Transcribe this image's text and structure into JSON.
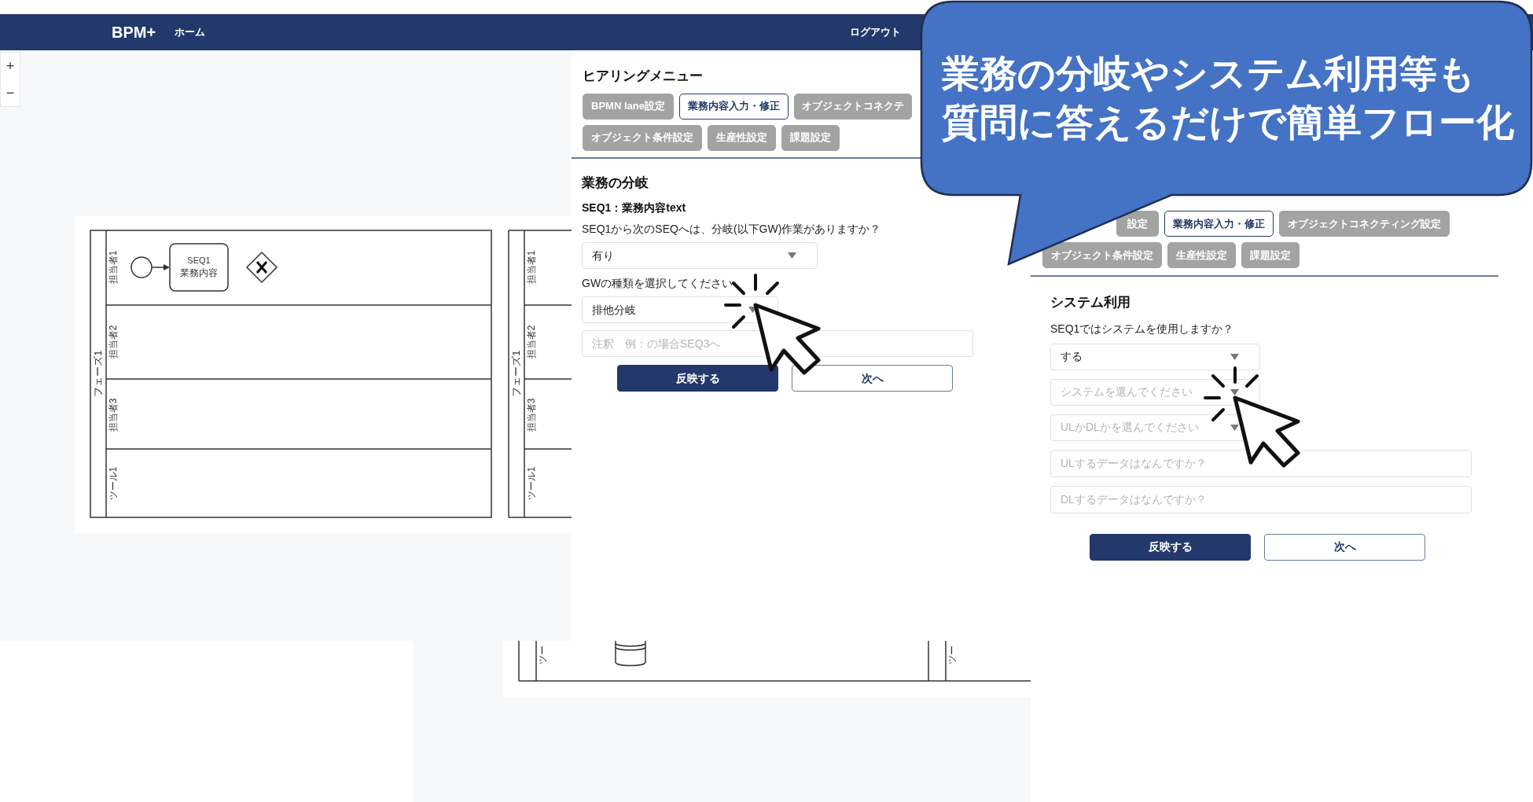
{
  "navbar": {
    "brand": "BPM+",
    "links": [
      "ホーム"
    ],
    "logout": "ログアウト"
  },
  "zoom_controls": [
    "+",
    "−"
  ],
  "diagram": {
    "pools": [
      {
        "phase": "フェーズ1",
        "lanes": [
          "担当者1",
          "担当者2",
          "担当者3",
          "ツール1"
        ]
      },
      {
        "phase": "フェーズ1",
        "lanes": [
          "担当者1",
          "担当者2",
          "担当者3",
          "ツール1"
        ]
      }
    ],
    "task": [
      "SEQ1",
      "業務内容"
    ]
  },
  "lower_diagram": {
    "lane_labels": [
      "ツー",
      "ツー"
    ]
  },
  "branch_panel": {
    "title": "ヒアリングメニュー",
    "tabs": [
      {
        "label": "BPMN lane設定",
        "selected": false
      },
      {
        "label": "業務内容入力・修正",
        "selected": true
      },
      {
        "label": "オブジェクトコネクテ",
        "selected": false
      },
      {
        "label": "オブジェクト条件設定",
        "selected": false
      },
      {
        "label": "生産性設定",
        "selected": false
      },
      {
        "label": "課題設定",
        "selected": false
      }
    ],
    "section_title": "業務の分岐",
    "seq_label": "SEQ1：業務内容text",
    "question": "SEQ1から次のSEQへは、分岐(以下GW)作業がありますか？",
    "answer": "有り",
    "gw_label": "GWの種類を選択してください",
    "gw_value": "排他分岐",
    "note_placeholder": "注釈　例：の場合SEQ3へ",
    "buttons": [
      {
        "label": "反映する",
        "kind": "primary"
      },
      {
        "label": "次へ",
        "kind": "secondary"
      }
    ]
  },
  "system_panel": {
    "tabs": [
      {
        "label": "設定",
        "selected": false
      },
      {
        "label": "業務内容入力・修正",
        "selected": true
      },
      {
        "label": "オブジェクトコネクティング設定",
        "selected": false
      },
      {
        "label": "オブジェクト条件設定",
        "selected": false
      },
      {
        "label": "生産性設定",
        "selected": false
      },
      {
        "label": "課題設定",
        "selected": false
      }
    ],
    "section_title": "システム利用",
    "question": "SEQ1ではシステムを使用しますか？",
    "fields": [
      {
        "kind": "select",
        "value": "する"
      },
      {
        "kind": "select",
        "placeholder": "システムを選んでください"
      },
      {
        "kind": "select",
        "placeholder": "ULかDLかを選んでください"
      },
      {
        "kind": "text",
        "placeholder": "ULするデータはなんですか？"
      },
      {
        "kind": "text",
        "placeholder": "DLするデータはなんですか？"
      }
    ],
    "buttons": [
      {
        "label": "反映する",
        "kind": "primary"
      },
      {
        "label": "次へ",
        "kind": "secondary"
      }
    ]
  },
  "callout": {
    "lines": [
      "業務の分岐やシステム利用等も",
      "質問に答えるだけで簡単フロー化"
    ]
  }
}
